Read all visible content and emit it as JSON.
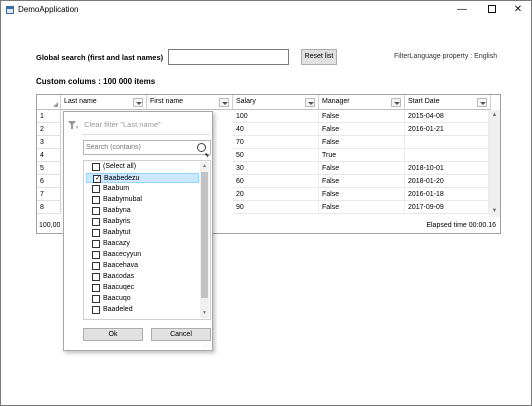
{
  "window": {
    "title": "DemoApplication",
    "minimize": "—",
    "close": "✕"
  },
  "toolbar": {
    "global_search_label": "Global search (first and last names)",
    "global_search_value": "",
    "reset_label": "Reset list",
    "filter_language": "FilterLanguage property : English"
  },
  "grid": {
    "caption": "Custom colums : 100 000 items",
    "columns": [
      "Last name",
      "First name",
      "Salary",
      "Manager",
      "Start Date"
    ],
    "rows": [
      {
        "n": "1",
        "salary": "100",
        "manager": "False",
        "start": "2015-04-08"
      },
      {
        "n": "2",
        "salary": "40",
        "manager": "False",
        "start": "2016-01-21"
      },
      {
        "n": "3",
        "salary": "70",
        "manager": "False",
        "start": ""
      },
      {
        "n": "4",
        "salary": "50",
        "manager": "True",
        "start": ""
      },
      {
        "n": "5",
        "salary": "30",
        "manager": "False",
        "start": "2018-10-01"
      },
      {
        "n": "6",
        "salary": "60",
        "manager": "False",
        "start": "2018-01-20"
      },
      {
        "n": "7",
        "salary": "20",
        "manager": "False",
        "start": "2016-01-18"
      },
      {
        "n": "8",
        "salary": "90",
        "manager": "False",
        "start": "2017-09-09"
      }
    ],
    "status_left": "100,00",
    "elapsed": "Elapsed time 00:00.16"
  },
  "filter_popup": {
    "clear_filter": "Clear filter \"Last name\"",
    "search_placeholder": "Search (contains)",
    "items": [
      {
        "label": "(Select all)",
        "checked": false
      },
      {
        "label": "Baabedezu",
        "checked": true
      },
      {
        "label": "Baabum",
        "checked": false
      },
      {
        "label": "Baabymubal",
        "checked": false
      },
      {
        "label": "Baabyna",
        "checked": false
      },
      {
        "label": "Baabyris",
        "checked": false
      },
      {
        "label": "Baabytut",
        "checked": false
      },
      {
        "label": "Baacazy",
        "checked": false
      },
      {
        "label": "Baacecyyun",
        "checked": false
      },
      {
        "label": "Baacehava",
        "checked": false
      },
      {
        "label": "Baacodas",
        "checked": false
      },
      {
        "label": "Baacuqec",
        "checked": false
      },
      {
        "label": "Baacuqo",
        "checked": false
      },
      {
        "label": "Baadeled",
        "checked": false
      }
    ],
    "ok_label": "Ok",
    "cancel_label": "Cancel"
  }
}
